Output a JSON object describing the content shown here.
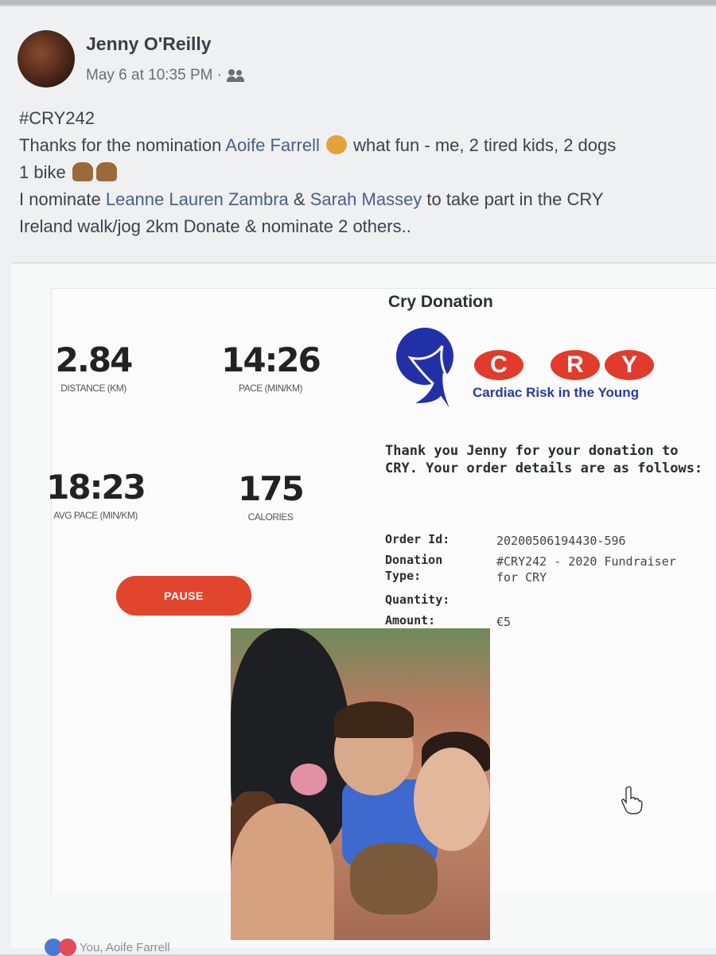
{
  "post": {
    "author": "Jenny O'Reilly",
    "timestamp": "May 6 at 10:35 PM ·",
    "audience_icon": "friends-icon",
    "text": {
      "hashtag": "#CRY242",
      "line2_a": "Thanks for the nomination ",
      "line2_mention": "Aoife Farrell",
      "line2_b": " what fun - me, 2 tired kids, 2 dogs",
      "line3": "1 bike",
      "line4_a": "I nominate ",
      "line4_mention1": "Leanne Lauren Zambra",
      "line4_amp": " & ",
      "line4_mention2": "Sarah Massey",
      "line4_b": " to take part in the CRY",
      "line5": "Ireland walk/jog 2km Donate & nominate 2 others.."
    }
  },
  "run": {
    "distance_value": "2.84",
    "distance_label": "DISTANCE (KM)",
    "pace_value": "14:26",
    "pace_label": "PACE (MIN/KM)",
    "avg_pace_value": "18:23",
    "avg_pace_label": "AVG PACE (MIN/KM)",
    "calories_value": "175",
    "calories_label": "CALORIES",
    "pause_label": "PAUSE"
  },
  "donation": {
    "title": "Cry Donation",
    "logo_letters": [
      "C",
      "R",
      "Y"
    ],
    "tagline": "Cardiac Risk in the Young",
    "thanks": "Thank you Jenny for your donation to CRY. Your order details are as follows:",
    "order_id_label": "Order Id:",
    "order_id": "20200506194430-596",
    "type_label": "Donation Type:",
    "type_value": "#CRY242 - 2020 Fundraiser for CRY",
    "quantity_label": "Quantity:",
    "amount_label": "Amount:",
    "amount_value": "€5"
  },
  "reactions": {
    "text": "You, Aoife Farrell"
  },
  "colors": {
    "accent_red": "#e0462e",
    "cry_blue": "#2a3b9a"
  }
}
